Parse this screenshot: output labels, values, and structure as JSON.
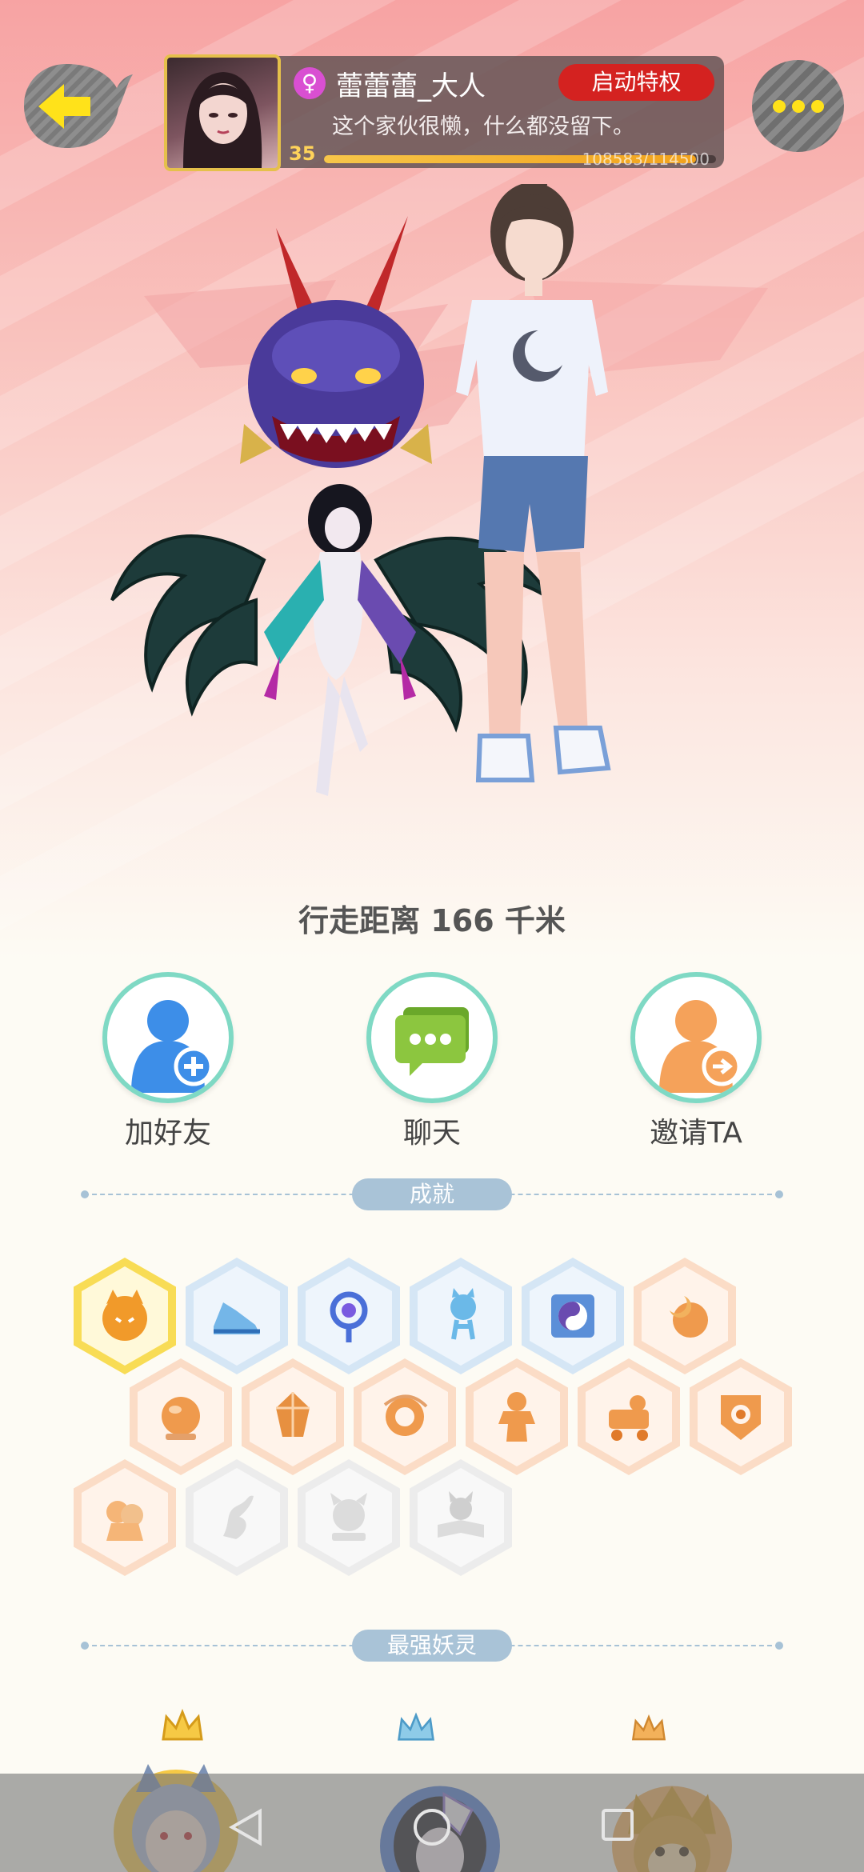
{
  "profile": {
    "name": "蕾蕾蕾_大人",
    "gender_symbol": "♀",
    "bio": "这个家伙很懒，什么都没留下。",
    "level": "35",
    "xp_text": "108583/114500",
    "xp_progress": 0.948,
    "vip_button": "启动特权"
  },
  "stats": {
    "distance": "行走距离 166 千米"
  },
  "actions": [
    {
      "label": "加好友",
      "icon": "add-friend-icon",
      "color": "#3d8ee8"
    },
    {
      "label": "聊天",
      "icon": "chat-icon",
      "color": "#8cc63f"
    },
    {
      "label": "邀请TA",
      "icon": "invite-icon",
      "color": "#f5a25a"
    }
  ],
  "achievements": {
    "title": "成就",
    "badges": [
      {
        "icon": "fox-face-icon",
        "state": "gold"
      },
      {
        "icon": "sneaker-icon",
        "state": "blue"
      },
      {
        "icon": "magnifier-icon",
        "state": "blue"
      },
      {
        "icon": "spirit-cat-icon",
        "state": "blue"
      },
      {
        "icon": "yin-yang-book-icon",
        "state": "blue"
      },
      {
        "icon": "moon-sun-icon",
        "state": "orange"
      },
      {
        "icon": "orb-icon",
        "state": "orange"
      },
      {
        "icon": "crystal-icon",
        "state": "orange"
      },
      {
        "icon": "taiji-swirl-icon",
        "state": "orange"
      },
      {
        "icon": "gingerbread-icon",
        "state": "orange"
      },
      {
        "icon": "stroller-icon",
        "state": "orange"
      },
      {
        "icon": "shield-badge-icon",
        "state": "orange"
      },
      {
        "icon": "cat-pair-icon",
        "state": "orange"
      },
      {
        "icon": "dragon-locked-icon",
        "state": "locked"
      },
      {
        "icon": "demon-locked-icon",
        "state": "locked"
      },
      {
        "icon": "fox-book-locked-icon",
        "state": "locked"
      }
    ]
  },
  "spirits": {
    "title": "最强妖灵"
  },
  "colors": {
    "accent_red": "#d42220",
    "teal_ring": "#7fd9c4",
    "section_blue": "#a9c3d7",
    "gold": "#f7c64a"
  }
}
